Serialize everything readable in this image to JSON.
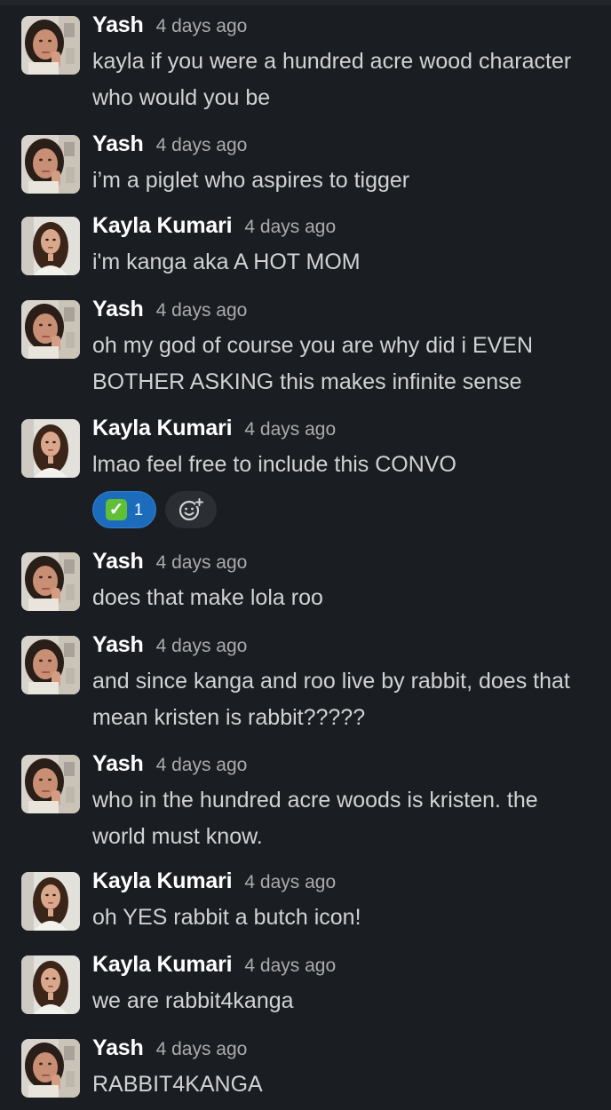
{
  "colors": {
    "background": "#1a1d21",
    "reaction_bg": "#1d6cbc",
    "check_green": "#5fbf36"
  },
  "messages": [
    {
      "author": "Yash",
      "time": "4 days ago",
      "avatar": "yash-avatar",
      "lines": [
        "kayla if you were a hundred acre wood character",
        "who would you be"
      ]
    },
    {
      "author": "Yash",
      "time": "4 days ago",
      "avatar": "yash-avatar",
      "lines": [
        "i’m a piglet who aspires to tigger"
      ]
    },
    {
      "author": "Kayla Kumari",
      "time": "4 days ago",
      "avatar": "kayla-avatar",
      "lines": [
        "i'm kanga aka A HOT MOM"
      ]
    },
    {
      "author": "Yash",
      "time": "4 days ago",
      "avatar": "yash-avatar",
      "lines": [
        "oh my god of course you are why did i EVEN",
        "BOTHER ASKING this makes infinite sense"
      ]
    },
    {
      "author": "Kayla Kumari",
      "time": "4 days ago",
      "avatar": "kayla-avatar",
      "lines": [
        "lmao feel free to include this CONVO"
      ],
      "reactions": [
        {
          "emoji": "white-check-mark-icon",
          "count": "1"
        }
      ]
    },
    {
      "author": "Yash",
      "time": "4 days ago",
      "avatar": "yash-avatar",
      "lines": [
        "does that make lola roo"
      ]
    },
    {
      "author": "Yash",
      "time": "4 days ago",
      "avatar": "yash-avatar",
      "lines": [
        "and since kanga and roo live by rabbit, does that",
        "mean kristen is rabbit?????"
      ]
    },
    {
      "author": "Yash",
      "time": "4 days ago",
      "avatar": "yash-avatar",
      "lines": [
        "who in the hundred acre woods is kristen. the",
        "world must know."
      ]
    },
    {
      "author": "Kayla Kumari",
      "time": "4 days ago",
      "avatar": "kayla-avatar",
      "lines": [
        "oh YES rabbit a butch icon!"
      ]
    },
    {
      "author": "Kayla Kumari",
      "time": "4 days ago",
      "avatar": "kayla-avatar",
      "lines": [
        "we are rabbit4kanga"
      ]
    },
    {
      "author": "Yash",
      "time": "4 days ago",
      "avatar": "yash-avatar",
      "lines": [
        "RABBIT4KANGA"
      ]
    }
  ]
}
